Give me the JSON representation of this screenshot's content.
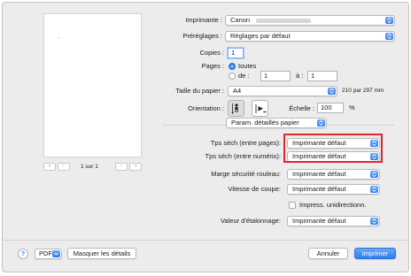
{
  "preview": {
    "page_counter": "1 sur 1",
    "nav": [
      "«",
      "‹",
      "›",
      "»"
    ]
  },
  "printer": {
    "label": "Imprimante :",
    "value": "Canon"
  },
  "presets": {
    "label": "Préréglages :",
    "value": "Réglages par défaut"
  },
  "copies": {
    "label": "Copies :",
    "value": "1"
  },
  "pages": {
    "label": "Pages :",
    "all_label": "toutes",
    "from_label": "de :",
    "from_value": "1",
    "to_label": "à :",
    "to_value": "1",
    "selected": "toutes"
  },
  "paper_size": {
    "label": "Taille du papier :",
    "value": "A4",
    "dimensions": "210 par 297 mm"
  },
  "orientation": {
    "label": "Orientation :",
    "scale_label": "Échelle :",
    "scale_value": "100",
    "scale_unit": "%"
  },
  "section_popup": {
    "value": "Param. détaillés papier"
  },
  "settings": [
    {
      "label": "Tps séch (entre pages):",
      "value": "Imprimante défaut"
    },
    {
      "label": "Tps séch (entre numéris):",
      "value": "Imprimante défaut"
    },
    {
      "label": "Marge sécurité rouleau:",
      "value": "Imprimante défaut"
    },
    {
      "label": "Vitesse de coupe:",
      "value": "Imprimante défaut"
    }
  ],
  "unidirectional": {
    "label": "Impress. unidirectionn.",
    "checked": false
  },
  "calibration": {
    "label": "Valeur d'étalonnage:",
    "value": "Imprimante défaut"
  },
  "footer": {
    "help": "?",
    "pdf": "PDF",
    "hide_details": "Masquer les détails",
    "cancel": "Annuler",
    "print": "Imprimer"
  },
  "colors": {
    "accent": "#2f7ef0",
    "highlight": "#e0262e"
  }
}
